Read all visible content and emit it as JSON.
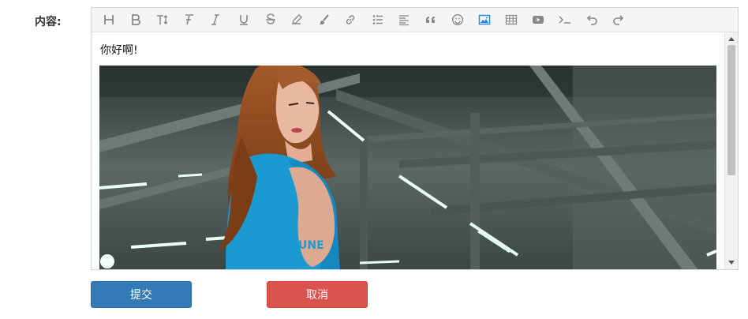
{
  "form": {
    "content_label": "内容:"
  },
  "editor": {
    "toolbar": [
      {
        "name": "heading-icon"
      },
      {
        "name": "bold-icon"
      },
      {
        "name": "font-size-icon"
      },
      {
        "name": "font-family-icon"
      },
      {
        "name": "italic-icon"
      },
      {
        "name": "underline-icon"
      },
      {
        "name": "strikethrough-icon"
      },
      {
        "name": "pen-icon"
      },
      {
        "name": "brush-icon"
      },
      {
        "name": "link-icon"
      },
      {
        "name": "list-icon"
      },
      {
        "name": "align-icon"
      },
      {
        "name": "quote-icon"
      },
      {
        "name": "emoji-icon"
      },
      {
        "name": "image-icon"
      },
      {
        "name": "table-icon"
      },
      {
        "name": "video-icon"
      },
      {
        "name": "code-icon"
      },
      {
        "name": "undo-icon"
      },
      {
        "name": "redo-icon"
      }
    ],
    "body_text": "你好啊!",
    "accent": "#1e88e5"
  },
  "actions": {
    "submit_label": "提交",
    "cancel_label": "取消",
    "submit_color": "#337ab7",
    "cancel_color": "#d9534f"
  }
}
